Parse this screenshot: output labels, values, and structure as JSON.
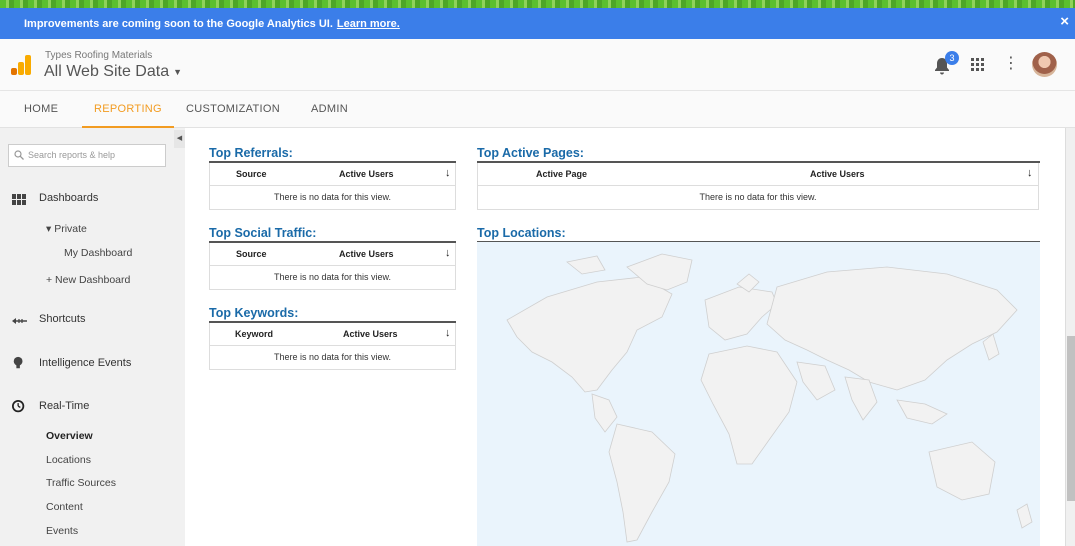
{
  "banner": {
    "text": "Improvements are coming soon to the Google Analytics UI.",
    "link": "Learn more.",
    "close": "×"
  },
  "header": {
    "account": "Types Roofing Materials",
    "property": "All Web Site Data",
    "notification_count": "3"
  },
  "nav": {
    "tabs": [
      "HOME",
      "REPORTING",
      "CUSTOMIZATION",
      "ADMIN"
    ],
    "active": "REPORTING"
  },
  "sidebar": {
    "search_placeholder": "Search reports & help",
    "dashboards": "Dashboards",
    "private": "▾ Private",
    "my_dashboard": "My Dashboard",
    "new_dashboard": "+ New Dashboard",
    "shortcuts": "Shortcuts",
    "intelligence": "Intelligence Events",
    "realtime": "Real-Time",
    "realtime_items": [
      "Overview",
      "Locations",
      "Traffic Sources",
      "Content",
      "Events"
    ]
  },
  "panels": {
    "referrals": {
      "title": "Top Referrals:",
      "col1": "Source",
      "col2": "Active Users",
      "empty": "There is no data for this view."
    },
    "social": {
      "title": "Top Social Traffic:",
      "col1": "Source",
      "col2": "Active Users",
      "empty": "There is no data for this view."
    },
    "keywords": {
      "title": "Top Keywords:",
      "col1": "Keyword",
      "col2": "Active Users",
      "empty": "There is no data for this view."
    },
    "pages": {
      "title": "Top Active Pages:",
      "col1": "Active Page",
      "col2": "Active Users",
      "empty": "There is no data for this view."
    },
    "locations": {
      "title": "Top Locations:"
    }
  },
  "sort_glyph": "↓",
  "colors": {
    "banner": "#3b7ee9",
    "accent": "#f29c22",
    "title": "#1a6aa8"
  }
}
